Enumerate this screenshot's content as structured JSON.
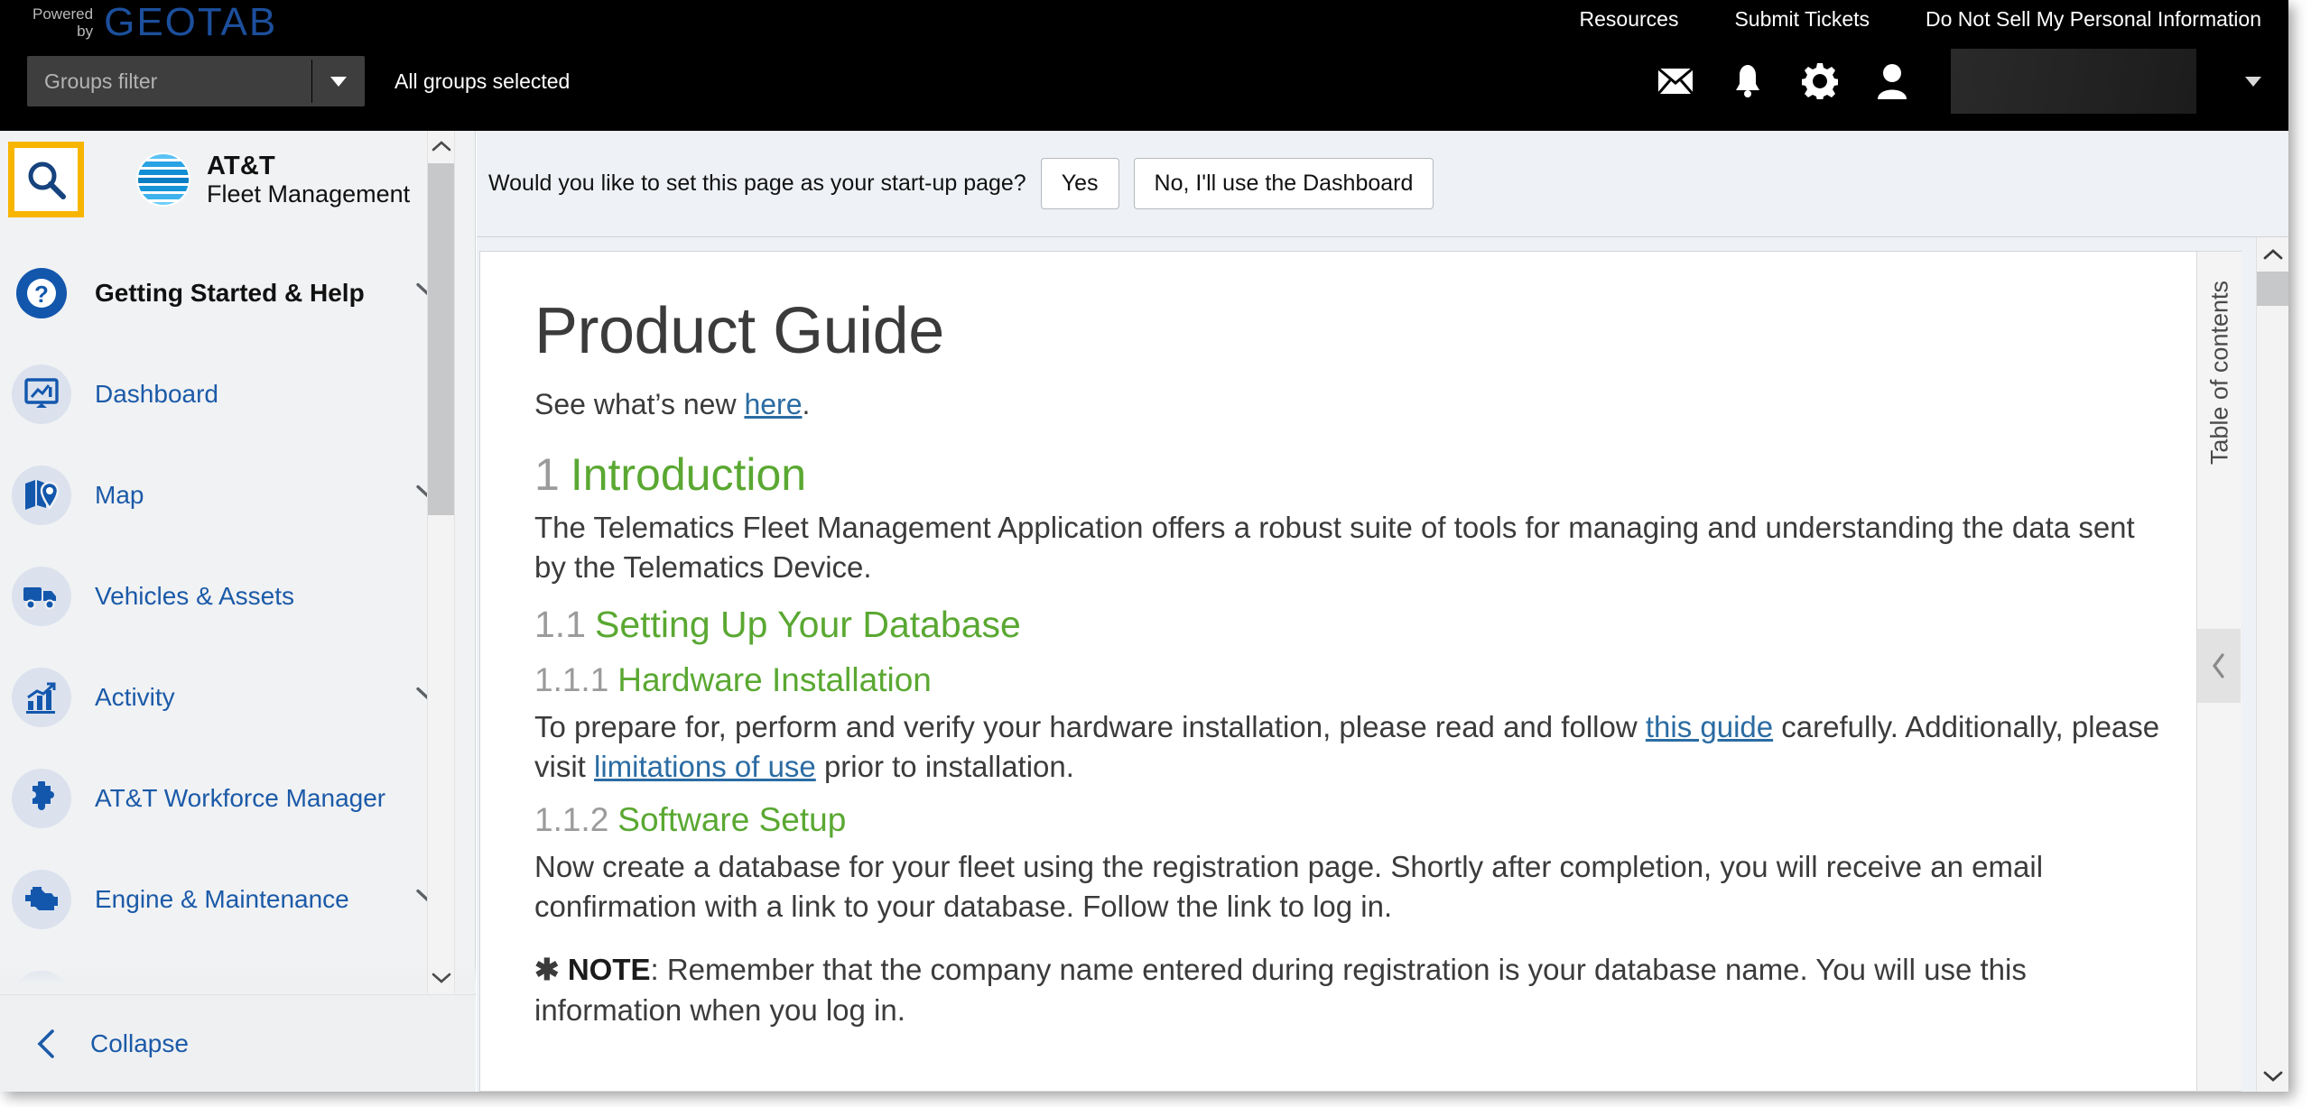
{
  "topbar": {
    "powered_line1": "Powered",
    "powered_line2": "by",
    "brand": "GEOTAB",
    "nav": [
      {
        "label": "Resources"
      },
      {
        "label": "Submit Tickets"
      },
      {
        "label": "Do Not Sell My Personal Information"
      }
    ],
    "groups_filter_placeholder": "Groups filter",
    "groups_filter_value": "",
    "groups_status": "All groups selected",
    "icons": [
      {
        "name": "mail-icon"
      },
      {
        "name": "bell-icon"
      },
      {
        "name": "gear-icon"
      },
      {
        "name": "user-icon"
      }
    ],
    "user_name": ""
  },
  "sidebar": {
    "search_icon": "search-icon",
    "logo_title": "AT&T",
    "logo_subtitle": "Fleet Management",
    "items": [
      {
        "label": "Getting Started & Help",
        "icon": "help-circle-icon",
        "expandable": true,
        "primary": true
      },
      {
        "label": "Dashboard",
        "icon": "dashboard-monitor-icon",
        "expandable": false,
        "primary": false
      },
      {
        "label": "Map",
        "icon": "map-pin-icon",
        "expandable": true,
        "primary": false
      },
      {
        "label": "Vehicles & Assets",
        "icon": "truck-icon",
        "expandable": false,
        "primary": false
      },
      {
        "label": "Activity",
        "icon": "bar-chart-icon",
        "expandable": true,
        "primary": false
      },
      {
        "label": "AT&T Workforce Manager",
        "icon": "puzzle-piece-icon",
        "expandable": false,
        "primary": false
      },
      {
        "label": "Engine & Maintenance",
        "icon": "engine-icon",
        "expandable": true,
        "primary": false
      },
      {
        "label": "",
        "icon": "envelope-icon",
        "expandable": true,
        "primary": false
      }
    ],
    "collapse_label": "Collapse"
  },
  "startup": {
    "question": "Would you like to set this page as your start-up page?",
    "yes_label": "Yes",
    "no_label": "No, I'll use the Dashboard"
  },
  "doc": {
    "title": "Product Guide",
    "subtitle_pre": "See what’s new ",
    "subtitle_link": "here",
    "subtitle_post": ".",
    "sections": [
      {
        "num": "1",
        "heading": "Introduction",
        "body": "The Telematics Fleet Management Application offers a robust suite of tools for managing and understanding the data sent by the Telematics Device."
      }
    ],
    "sub_heading_num": "1.1",
    "sub_heading": "Setting Up Your Database",
    "h3a_num": "1.1.1",
    "h3a": "Hardware Installation",
    "h3a_body_pre": "To prepare for, perform and verify your hardware installation, please read and follow ",
    "h3a_link1": "this guide",
    "h3a_body_mid": " carefully. Additionally, please visit ",
    "h3a_link2": "limitations of use",
    "h3a_body_post": " prior to installation.",
    "h3b_num": "1.1.2",
    "h3b": "Software Setup",
    "h3b_body": "Now create a database for your fleet using the registration page. Shortly after completion, you will receive an email confirmation with a link to your database. Follow the link to log in.",
    "note_star": "✱",
    "note_label": "NOTE",
    "note_body": ": Remember that the company name entered during registration is your database name. You will use this information when you log in."
  },
  "toc": {
    "label": "Table of contents",
    "collapse_icon": "chevron-left-icon"
  },
  "colors": {
    "brand_blue": "#1c4f9c",
    "accent_yellow": "#f7b500",
    "link_blue": "#2b6ca3",
    "heading_green": "#5aa832",
    "nav_blue": "#1b5aa8"
  }
}
